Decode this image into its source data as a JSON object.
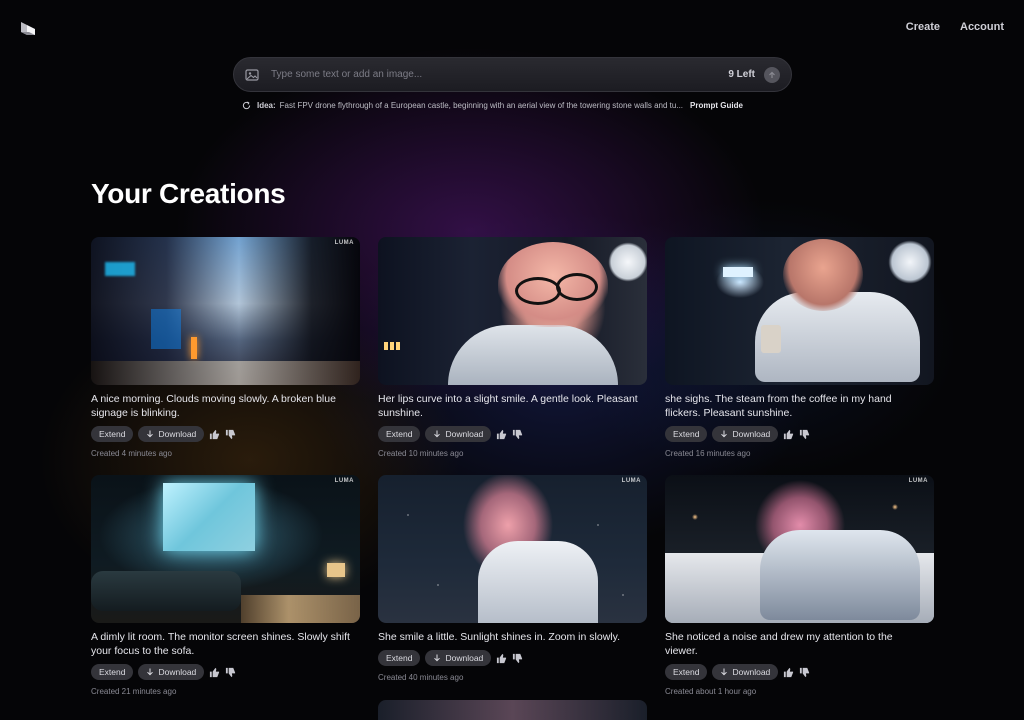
{
  "nav": {
    "create": "Create",
    "account": "Account"
  },
  "prompt": {
    "placeholder": "Type some text or add an image...",
    "left_count": "9 Left",
    "idea_label": "Idea:",
    "idea_text": "Fast FPV drone flythrough of a European castle, beginning with an aerial view of the towering stone walls and tu...",
    "guide_label": "Prompt Guide"
  },
  "section_title": "Your Creations",
  "watermark": "LUMA",
  "actions": {
    "extend": "Extend",
    "download": "Download"
  },
  "creations": [
    {
      "caption": "A nice morning. Clouds moving slowly. A broken blue signage is blinking.",
      "created": "Created 4 minutes ago"
    },
    {
      "caption": "Her lips curve into a slight smile. A gentle look. Pleasant sunshine.",
      "created": "Created 10 minutes ago"
    },
    {
      "caption": "she sighs. The steam from the coffee in my hand flickers. Pleasant sunshine.",
      "created": "Created 16 minutes ago"
    },
    {
      "caption": "A dimly lit room. The monitor screen shines. Slowly shift your focus to the sofa.",
      "created": "Created 21 minutes ago"
    },
    {
      "caption": "She smile a little. Sunlight shines in. Zoom in slowly.",
      "created": "Created 40 minutes ago"
    },
    {
      "caption": "She noticed a noise and drew my attention to the viewer.",
      "created": "Created about 1 hour ago"
    }
  ],
  "icons": {
    "logo": "luma-logo-icon",
    "image_add": "image-icon",
    "submit": "arrow-up-icon",
    "refresh": "refresh-icon",
    "download": "download-icon",
    "like": "thumbs-up-icon",
    "dislike": "thumbs-down-icon"
  }
}
